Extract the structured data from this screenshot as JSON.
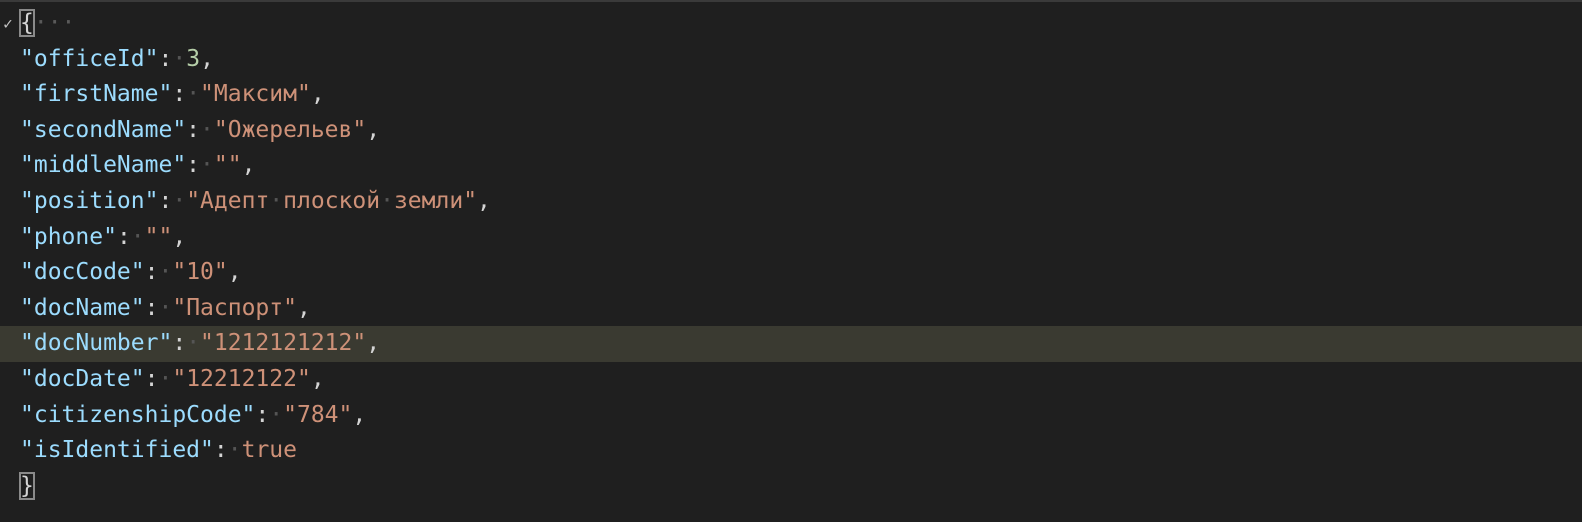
{
  "editor": {
    "open_brace": "{",
    "close_brace": "}",
    "collapsed_marker": "···",
    "fold_icon": "checkmark-icon",
    "entries": [
      {
        "key": "\"officeId\"",
        "value": "3",
        "type": "number",
        "comma": ","
      },
      {
        "key": "\"firstName\"",
        "value": "\"Максим\"",
        "type": "string",
        "comma": ","
      },
      {
        "key": "\"secondName\"",
        "value": "\"Ожерельев\"",
        "type": "string",
        "comma": ","
      },
      {
        "key": "\"middleName\"",
        "value": "\"\"",
        "type": "string",
        "comma": ","
      },
      {
        "key": "\"position\"",
        "value": "\"Адепт·плоской·земли\"",
        "type": "string",
        "comma": ","
      },
      {
        "key": "\"phone\"",
        "value": "\"\"",
        "type": "string",
        "comma": ","
      },
      {
        "key": "\"docCode\"",
        "value": "\"10\"",
        "type": "string",
        "comma": ","
      },
      {
        "key": "\"docName\"",
        "value": "\"Паспорт\"",
        "type": "string",
        "comma": ","
      },
      {
        "key": "\"docNumber\"",
        "value": "\"1212121212\"",
        "type": "string",
        "comma": ","
      },
      {
        "key": "\"docDate\"",
        "value": "\"12212122\"",
        "type": "string",
        "comma": ","
      },
      {
        "key": "\"citizenshipCode\"",
        "value": "\"784\"",
        "type": "string",
        "comma": ","
      },
      {
        "key": "\"isIdentified\"",
        "value": "true",
        "type": "boolean",
        "comma": ""
      }
    ],
    "colon": ":",
    "whitespace_marker": "·",
    "current_line_index": 8
  },
  "colors": {
    "background": "#1f1f1f",
    "key": "#9cdcfe",
    "string": "#ce9178",
    "number": "#b5cea8",
    "current_line": "#3a3a31"
  }
}
